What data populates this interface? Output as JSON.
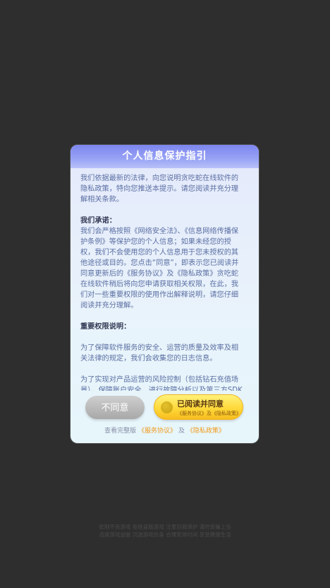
{
  "dialog": {
    "title": "个人信息保护指引",
    "intro": "我们依据最新的法律，向您说明贪吃蛇在线软件的隐私政策，特向您推送本提示。请您阅读并充分理解相关条款。",
    "commitment_heading": "我们承诺：",
    "commitment_text": "我们会严格按照《网络安全法》、《信息网络传播保护条例》等保护您的个人信息；如果未经您的授权，我们不会使用您的个人信息用于您未授权的其他途径或目的。您点击“同意”，即表示您已阅读并同意更新后的《服务协议》及《隐私政策》贪吃蛇在线软件稍后将向您申请获取相关权限，在此，我们对一些重要权限的使用作出解释说明，请您仔细阅读并充分理解。",
    "permissions_heading": "重要权限说明：",
    "permissions_text_1": "为了保障软件服务的安全、运营的质量及效率及相关法律的规定，我们会收集您的日志信息。",
    "permissions_text_2": "为了实现对产品运营的风险控制（包括钻石充值场景）、保障账户安全、进行故障分析以及第三方SDK",
    "disagree_label": "不同意",
    "agree_label": "已阅读并同意",
    "agree_sub": "《服务协议》及《隐私政策》",
    "footer_prefix": "查看完整版",
    "footer_service_link": "《服务协议》",
    "footer_and": "及",
    "footer_privacy_link": "《隐私政策》"
  },
  "bottom_notice": {
    "line1": "抵制不良游戏  拒绝盗版游戏  注意自我保护  谨防受骗上当",
    "line2": "适度游戏益脑  沉迷游戏伤身  合理安排时间  享受健康生活"
  },
  "colors": {
    "background": "#2e2e2e",
    "header": "#7d86ee",
    "link": "#f19a1a",
    "agree_button": "#ffd93a",
    "disagree_button": "#a8a8a8"
  }
}
